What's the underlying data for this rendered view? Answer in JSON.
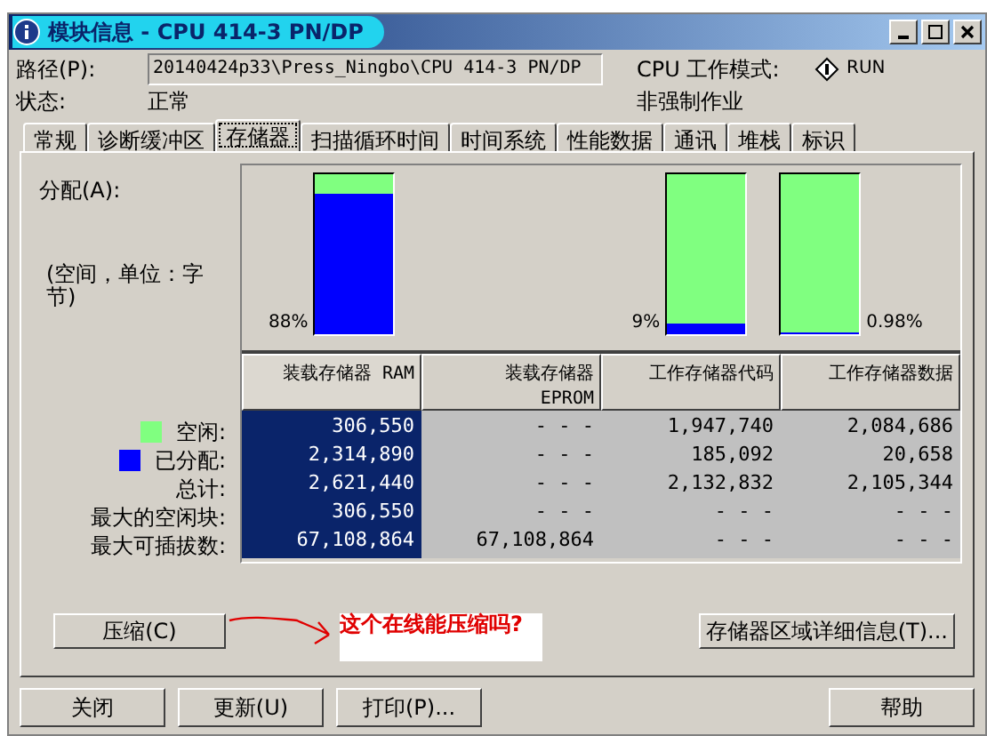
{
  "window": {
    "title": "模块信息 - CPU 414-3 PN/DP"
  },
  "header": {
    "path_label": "路径(P):",
    "path_value": "20140424p33\\Press_Ningbo\\CPU 414-3 PN/DP",
    "mode_label": "CPU 工作模式:",
    "mode_value": "RUN",
    "status_label": "状态:",
    "status_value": "正常",
    "force_status": "非强制作业"
  },
  "tabs": [
    {
      "label": "常规",
      "selected": false
    },
    {
      "label": "诊断缓冲区",
      "selected": false
    },
    {
      "label": "存储器",
      "selected": true
    },
    {
      "label": "扫描循环时间",
      "selected": false
    },
    {
      "label": "时间系统",
      "selected": false
    },
    {
      "label": "性能数据",
      "selected": false
    },
    {
      "label": "通讯",
      "selected": false
    },
    {
      "label": "堆栈",
      "selected": false
    },
    {
      "label": "标识",
      "selected": false
    }
  ],
  "memory": {
    "allocation_label": "分配(A):",
    "unit_label": "(空间，单位：字节)",
    "bars": [
      {
        "percent": "88%",
        "level": 0.88,
        "kind": "label_left"
      },
      {
        "percent": "9%",
        "level": 0.07,
        "kind": "label_left"
      },
      {
        "percent": "0.98%",
        "level": 0.0098,
        "kind": "label_right"
      }
    ],
    "columns": [
      {
        "label": "装载存储器 RAM",
        "selected": true
      },
      {
        "label": "装载存储器 EPROM",
        "selected": false
      },
      {
        "label": "工作存储器代码",
        "selected": false
      },
      {
        "label": "工作存储器数据",
        "selected": false
      }
    ],
    "rows": [
      {
        "label": "空闲:",
        "color": "#80ff80",
        "cells": [
          "306,550",
          "- - -",
          "1,947,740",
          "2,084,686"
        ]
      },
      {
        "label": "已分配:",
        "color": "#0000ff",
        "cells": [
          "2,314,890",
          "- - -",
          "185,092",
          "20,658"
        ]
      },
      {
        "label": "总计:",
        "cells": [
          "2,621,440",
          "- - -",
          "2,132,832",
          "2,105,344"
        ]
      },
      {
        "label": "最大的空闲块:",
        "cells": [
          "306,550",
          "- - -",
          "- - -",
          "- - -"
        ]
      },
      {
        "label": "最大可插拔数:",
        "cells": [
          "67,108,864",
          "67,108,864",
          "- - -",
          "- - -"
        ]
      }
    ],
    "compress_button": "压缩(C)",
    "annotation": "这个在线能压缩吗?",
    "details_button": "存储器区域详细信息(T)..."
  },
  "buttons": [
    {
      "label": "关闭",
      "kind": "left"
    },
    {
      "label": "更新(U)",
      "kind": "left"
    },
    {
      "label": "打印(P)...",
      "kind": "left"
    },
    {
      "label": "帮助",
      "kind": "right"
    }
  ]
}
